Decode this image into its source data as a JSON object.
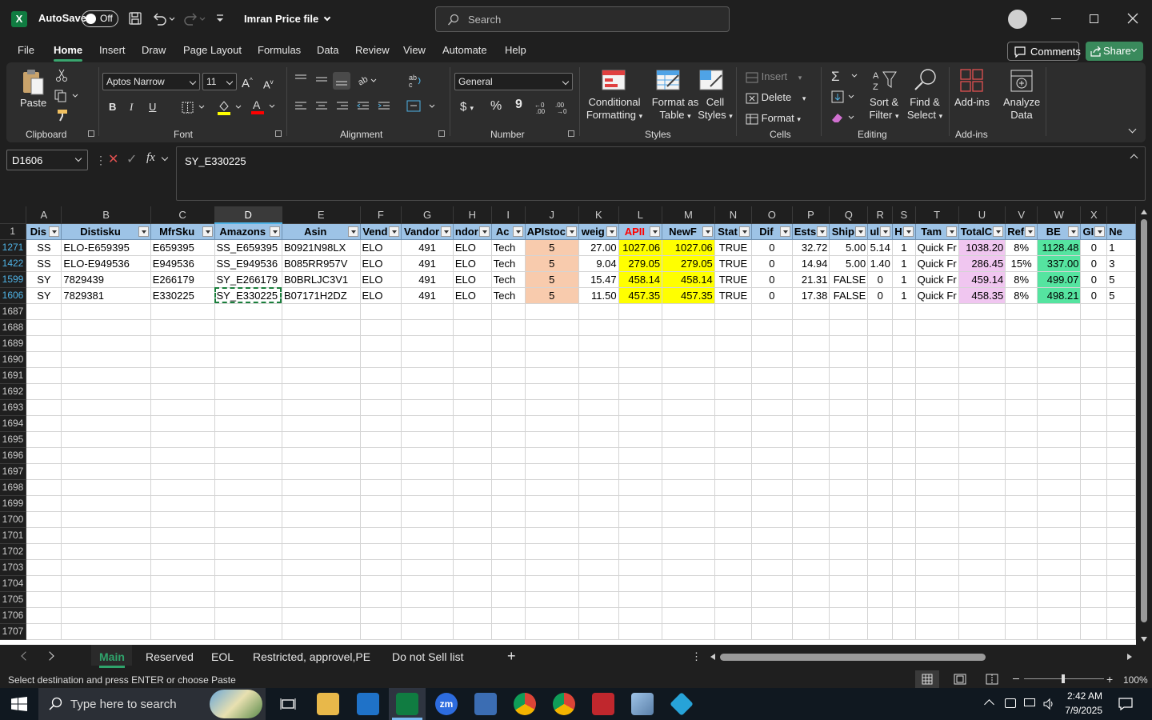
{
  "window": {
    "app_logo": "X",
    "autosave_label": "AutoSave",
    "autosave_state": "Off",
    "doc_title": "Imran Price file",
    "search_placeholder": "Search"
  },
  "menu": {
    "tabs": [
      "File",
      "Home",
      "Insert",
      "Draw",
      "Page Layout",
      "Formulas",
      "Data",
      "Review",
      "View",
      "Automate",
      "Help"
    ],
    "active": "Home",
    "comments": "Comments",
    "share": "Share"
  },
  "ribbon": {
    "clipboard": {
      "paste": "Paste",
      "label": "Clipboard"
    },
    "font": {
      "name": "Aptos Narrow",
      "size": "11",
      "label": "Font",
      "bold": "B",
      "italic": "I",
      "underline": "U",
      "fill_color": "#ffff00",
      "font_color": "#ff0000"
    },
    "alignment": {
      "label": "Alignment"
    },
    "number": {
      "format": "General",
      "label": "Number",
      "currency": "$",
      "percent": "%",
      "comma": "9"
    },
    "styles": {
      "conditional": [
        "Conditional",
        "Formatting"
      ],
      "format_table": [
        "Format as",
        "Table"
      ],
      "cell_styles": [
        "Cell",
        "Styles"
      ],
      "label": "Styles"
    },
    "cells": {
      "insert": "Insert",
      "delete": "Delete",
      "format": "Format",
      "label": "Cells"
    },
    "editing": {
      "sort": [
        "Sort &",
        "Filter"
      ],
      "find": [
        "Find &",
        "Select"
      ],
      "label": "Editing"
    },
    "addins": {
      "addins": "Add-ins",
      "analyze": [
        "Analyze",
        "Data"
      ],
      "label": "Add-ins"
    }
  },
  "formula_bar": {
    "name_box": "D1606",
    "cancel": "✕",
    "enter": "✓",
    "fx": "fx",
    "content": "SY_E330225"
  },
  "grid": {
    "columns": [
      "A",
      "B",
      "C",
      "D",
      "E",
      "F",
      "G",
      "H",
      "I",
      "J",
      "K",
      "L",
      "M",
      "N",
      "O",
      "P",
      "Q",
      "R",
      "S",
      "T",
      "U",
      "V",
      "W",
      "X"
    ],
    "selected_column": "D",
    "header_row_num": "1",
    "headers": [
      "Dis",
      "Distisku",
      "MfrSku",
      "Amazons",
      "Asin",
      "Vend",
      "Vandor",
      "ndor",
      "Ac",
      "APIstoc",
      "weig",
      "APII",
      "NewF",
      "Stat",
      "Dif",
      "Ests",
      "Ship",
      "ul",
      "H",
      "Tam",
      "TotalC",
      "Ref",
      "BE",
      "GI",
      "Ne"
    ],
    "rows": [
      {
        "num": "1271",
        "cells": [
          "SS",
          "ELO-E659395",
          "E659395",
          "SS_E659395",
          "B0921N98LX",
          "ELO",
          "491",
          "ELO",
          "Tech",
          "5",
          "27.00",
          "1027.06",
          "1027.06",
          "TRUE",
          "0",
          "32.72",
          "5.00",
          "5.14",
          "1",
          "Quick Fr",
          "1038.20",
          "8%",
          "1128.48",
          "0",
          "1"
        ]
      },
      {
        "num": "1422",
        "cells": [
          "SS",
          "ELO-E949536",
          "E949536",
          "SS_E949536",
          "B085RR957V",
          "ELO",
          "491",
          "ELO",
          "Tech",
          "5",
          "9.04",
          "279.05",
          "279.05",
          "TRUE",
          "0",
          "14.94",
          "5.00",
          "1.40",
          "1",
          "Quick Fr",
          "286.45",
          "15%",
          "337.00",
          "0",
          "3"
        ]
      },
      {
        "num": "1599",
        "cells": [
          "SY",
          "7829439",
          "E266179",
          "SY_E266179",
          "B0BRLJC3V1",
          "ELO",
          "491",
          "ELO",
          "Tech",
          "5",
          "15.47",
          "458.14",
          "458.14",
          "TRUE",
          "0",
          "21.31",
          "FALSE",
          "0",
          "1",
          "Quick Fr",
          "459.14",
          "8%",
          "499.07",
          "0",
          "5"
        ]
      },
      {
        "num": "1606",
        "cells": [
          "SY",
          "7829381",
          "E330225",
          "SY_E330225",
          "B07171H2DZ",
          "ELO",
          "491",
          "ELO",
          "Tech",
          "5",
          "11.50",
          "457.35",
          "457.35",
          "TRUE",
          "0",
          "17.38",
          "FALSE",
          "0",
          "1",
          "Quick Fr",
          "458.35",
          "8%",
          "498.21",
          "0",
          "5"
        ]
      }
    ],
    "empty_rows": [
      "1687",
      "1688",
      "1689",
      "1690",
      "1691",
      "1692",
      "1693",
      "1694",
      "1695",
      "1696",
      "1697",
      "1698",
      "1699",
      "1700",
      "1701",
      "1702",
      "1703",
      "1704",
      "1705",
      "1706",
      "1707"
    ]
  },
  "sheets": {
    "tabs": [
      "Main",
      "Reserved",
      "EOL",
      "Restricted, approvel,PE",
      "Do not Sell list"
    ],
    "active": "Main",
    "add": "+"
  },
  "status": {
    "message": "Select destination and press ENTER or choose Paste",
    "zoom": "100%"
  },
  "taskbar": {
    "search_placeholder": "Type here to search",
    "zoom_app": "zm",
    "time": "2:42 AM",
    "date": "7/9/2025"
  }
}
